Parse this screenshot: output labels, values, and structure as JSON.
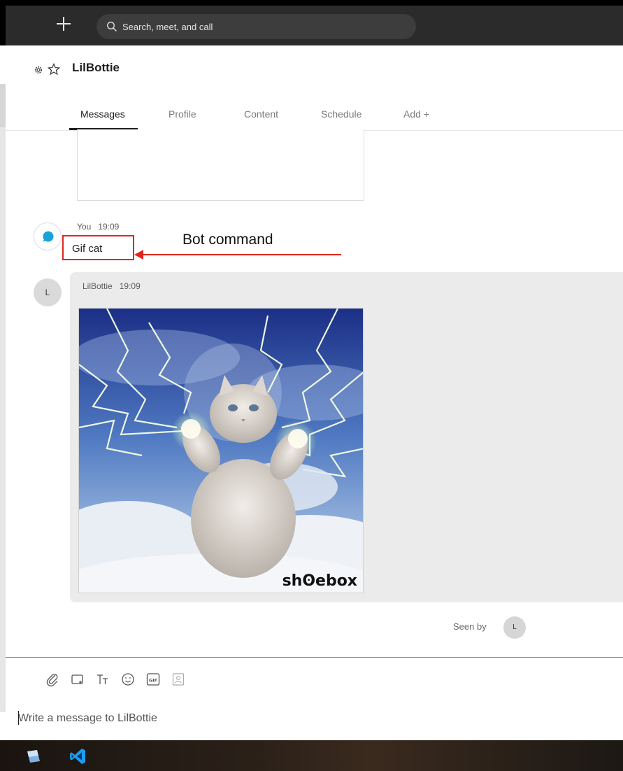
{
  "topbar": {
    "new_button_icon": "plus-icon",
    "search_placeholder": "Search, meet, and call",
    "search_icon": "search-icon"
  },
  "chat": {
    "title": "LilBottie",
    "settings_icon": "gear-icon",
    "favorite_icon": "star-icon"
  },
  "tabs": [
    {
      "label": "Messages",
      "active": true
    },
    {
      "label": "Profile",
      "active": false
    },
    {
      "label": "Content",
      "active": false
    },
    {
      "label": "Schedule",
      "active": false
    },
    {
      "label": "Add +",
      "active": false
    }
  ],
  "messages": {
    "you": {
      "sender": "You",
      "time": "19:09",
      "text": "Gif cat"
    },
    "bot": {
      "sender": "LilBottie",
      "time": "19:09",
      "avatar_initial": "L",
      "gif_watermark": "shʘebox"
    }
  },
  "annotation": {
    "label": "Bot command",
    "color": "#e0271f"
  },
  "seen": {
    "label": "Seen by",
    "avatar_initial": "L"
  },
  "compose": {
    "placeholder": "Write a message to LilBottie",
    "tools": [
      "attach-icon",
      "media-icon",
      "format-text-icon",
      "emoji-icon",
      "gif-icon",
      "contact-icon"
    ]
  },
  "taskbar": {
    "apps": [
      "app-icon",
      "vscode-icon"
    ]
  },
  "colors": {
    "accent": "#1aa3d9",
    "chat_bubble_icon": "#1aa3d9",
    "topbar": "#2b2b2b"
  }
}
